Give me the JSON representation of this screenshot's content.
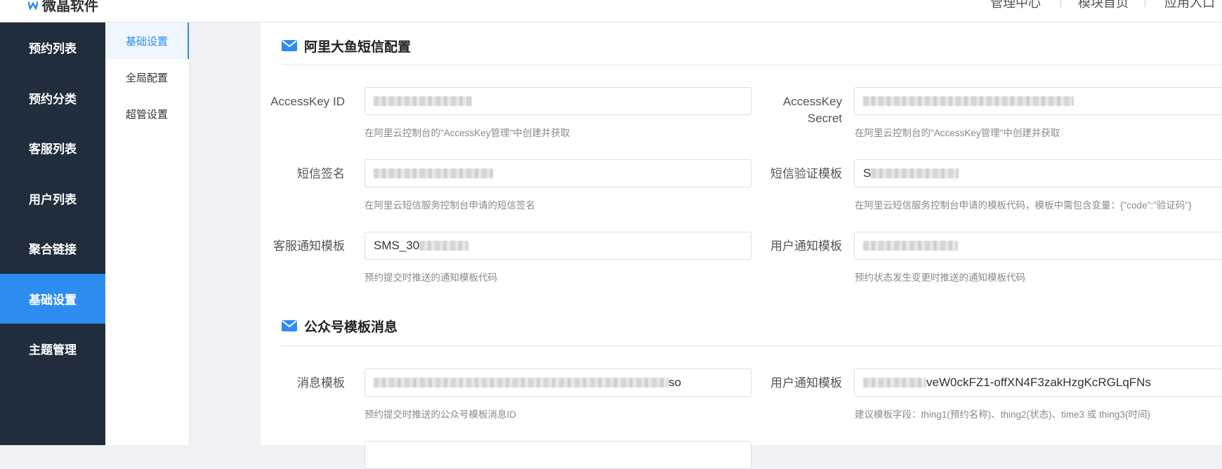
{
  "header": {
    "logo_text": "微晶软件",
    "nav": [
      "管理中心",
      "模块首页",
      "应用入口"
    ]
  },
  "sidebar": {
    "items": [
      {
        "label": "预约列表",
        "active": false
      },
      {
        "label": "预约分类",
        "active": false
      },
      {
        "label": "客服列表",
        "active": false
      },
      {
        "label": "用户列表",
        "active": false
      },
      {
        "label": "聚合链接",
        "active": false
      },
      {
        "label": "基础设置",
        "active": true
      },
      {
        "label": "主题管理",
        "active": false
      }
    ]
  },
  "subsidebar": {
    "items": [
      {
        "label": "基础设置",
        "active": true
      },
      {
        "label": "全局配置",
        "active": false
      },
      {
        "label": "超管设置",
        "active": false
      }
    ]
  },
  "sms_section": {
    "title": "阿里大鱼短信配置",
    "access_key_id": {
      "label": "AccessKey ID",
      "hint": "在阿里云控制台的\"AccessKey管理\"中创建并获取"
    },
    "access_key_secret": {
      "label_line1": "AccessKey",
      "label_line2": "Secret",
      "hint": "在阿里云控制台的\"AccessKey管理\"中创建并获取"
    },
    "sms_sign": {
      "label": "短信签名",
      "hint": "在阿里云短信服务控制台申请的短信签名"
    },
    "sms_verify_template": {
      "label": "短信验证模板",
      "value_prefix": "S",
      "hint": "在阿里云短信服务控制台申请的模板代码，模板中需包含变量：{\"code\":\"验证码\"}"
    },
    "staff_notify_template": {
      "label": "客服通知模板",
      "value_prefix": "SMS_30",
      "hint": "预约提交时推送的通知模板代码"
    },
    "user_notify_template": {
      "label": "用户通知模板",
      "hint": "预约状态发生变更时推送的通知模板代码"
    }
  },
  "wechat_section": {
    "title": "公众号模板消息",
    "message_template": {
      "label": "消息模板",
      "value_suffix": "so",
      "hint": "预约提交时推送的公众号模板消息ID"
    },
    "user_notify_template": {
      "label": "用户通知模板",
      "value_suffix": "veW0ckFZ1-offXN4F3zakHzgKcRGLqFNs",
      "hint": "建议模板字段：thing1(预约名称)、thing2(状态)、time3 或 thing3(时间)"
    }
  },
  "colors": {
    "sidebar_bg": "#1f2d3d",
    "accent": "#2d8cf0"
  }
}
